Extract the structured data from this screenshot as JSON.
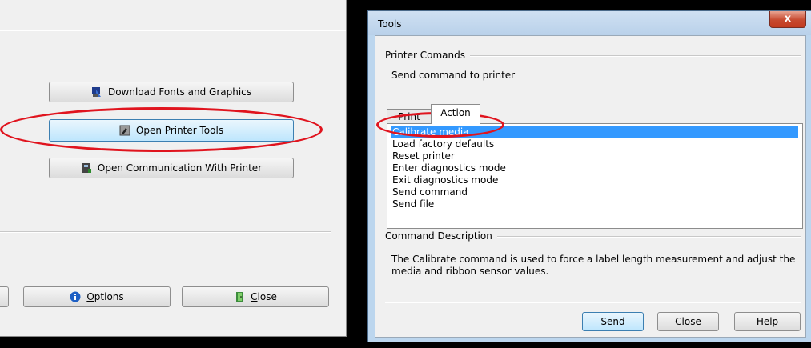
{
  "left_window": {
    "buttons": {
      "download_fonts": "Download Fonts and Graphics",
      "open_printer_tools": "Open Printer Tools",
      "open_communication": "Open Communication With Printer",
      "options_mnemonic": "O",
      "options_rest": "ptions",
      "close_mnemonic": "C",
      "close_rest": "lose"
    }
  },
  "tools_dialog": {
    "title": "Tools",
    "close_glyph": "x",
    "printer_commands_label": "Printer Comands",
    "instruction": "Send command to printer",
    "tabs": [
      {
        "label": "Print"
      },
      {
        "label": "Action"
      }
    ],
    "commands": [
      "Calibrate media",
      "Load factory defaults",
      "Reset printer",
      "Enter diagnostics mode",
      "Exit diagnostics mode",
      "Send command",
      "Send file"
    ],
    "selected_index": 0,
    "command_description_label": "Command Description",
    "command_description": "The Calibrate command is used to force a label length measurement and adjust the media and ribbon sensor values.",
    "buttons": {
      "send_mnemonic": "S",
      "send_rest": "end",
      "close_mnemonic": "C",
      "close_rest": "lose",
      "help_mnemonic": "H",
      "help_rest": "elp"
    }
  },
  "colors": {
    "annotation": "#e0141e",
    "selection": "#3399ff"
  }
}
